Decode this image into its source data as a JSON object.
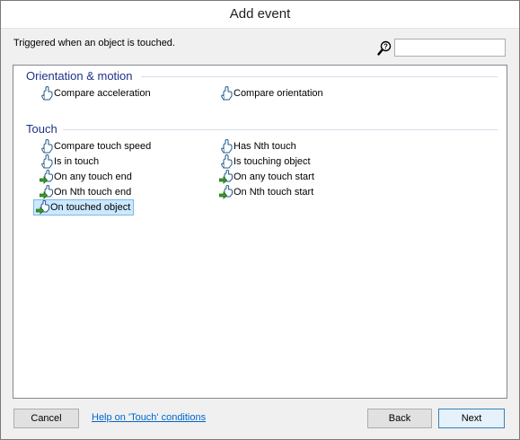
{
  "window": {
    "title": "Add event"
  },
  "description": "Triggered when an object is touched.",
  "search": {
    "value": "",
    "placeholder": ""
  },
  "groups": [
    {
      "header": "Orientation & motion",
      "items": [
        {
          "label": "Compare acceleration",
          "icon": "touch-condition-icon"
        },
        {
          "label": "Compare orientation",
          "icon": "touch-condition-icon"
        }
      ]
    },
    {
      "header": "Touch",
      "items": [
        {
          "label": "Compare touch speed",
          "icon": "touch-condition-icon"
        },
        {
          "label": "Has Nth touch",
          "icon": "touch-condition-icon"
        },
        {
          "label": "Is in touch",
          "icon": "touch-condition-icon"
        },
        {
          "label": "Is touching object",
          "icon": "touch-condition-icon"
        },
        {
          "label": "On any touch end",
          "icon": "touch-trigger-icon"
        },
        {
          "label": "On any touch start",
          "icon": "touch-trigger-icon"
        },
        {
          "label": "On Nth touch end",
          "icon": "touch-trigger-icon"
        },
        {
          "label": "On Nth touch start",
          "icon": "touch-trigger-icon"
        },
        {
          "label": "On touched object",
          "icon": "touch-trigger-icon",
          "selected": true
        }
      ]
    }
  ],
  "footer": {
    "cancel_label": "Cancel",
    "help_link": "Help on 'Touch' conditions",
    "back_label": "Back",
    "next_label": "Next"
  },
  "colors": {
    "selection": "#cce8ff",
    "group_header": "#1e3287",
    "link": "#0066cc",
    "trigger_arrow": "#3a9a2a"
  }
}
